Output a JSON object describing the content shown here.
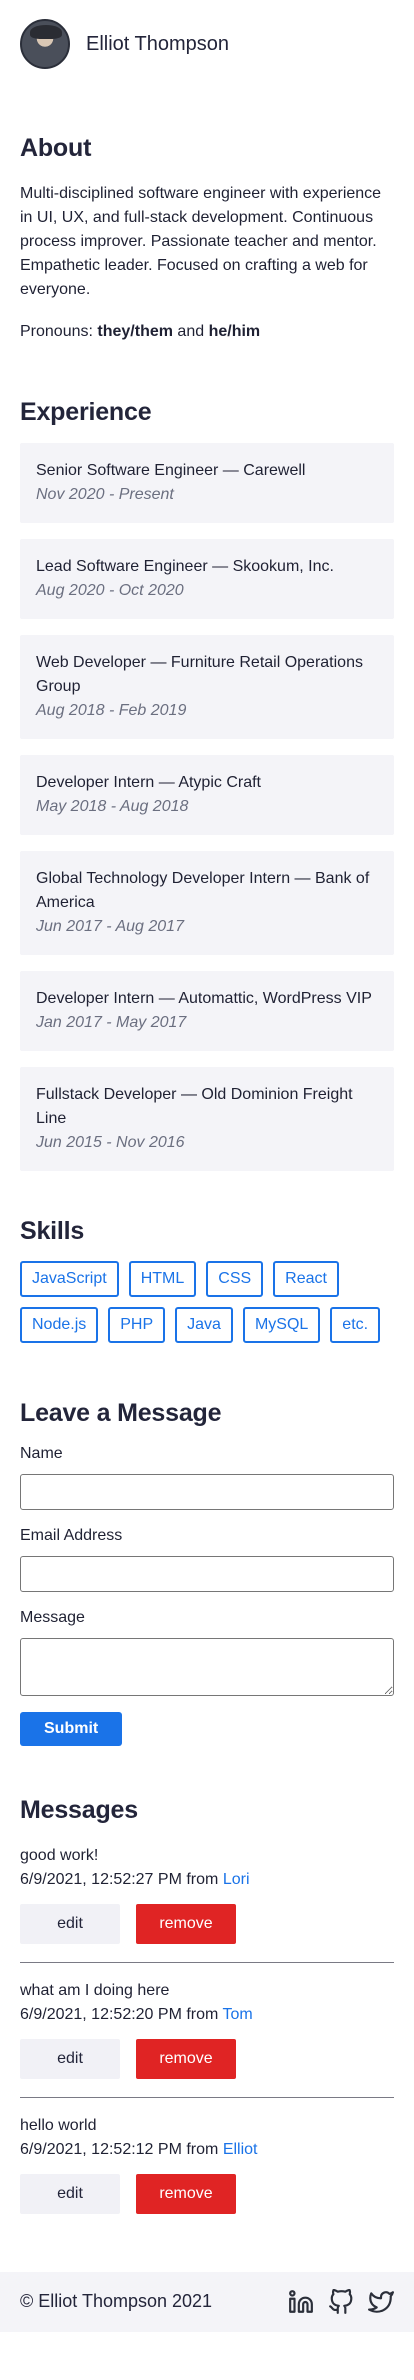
{
  "header": {
    "name": "Elliot Thompson"
  },
  "about": {
    "title": "About",
    "text": "Multi-disciplined software engineer with experience in UI, UX, and full-stack development. Continuous process improver. Passionate teacher and mentor. Empathetic leader. Focused on crafting a web for everyone.",
    "pronouns_label": "Pronouns:",
    "pronoun_1": "they/them",
    "pronoun_join": "and",
    "pronoun_2": "he/him"
  },
  "experience": {
    "title": "Experience",
    "items": [
      {
        "role": "Senior Software Engineer",
        "company": "Carewell",
        "dates": "Nov 2020 - Present"
      },
      {
        "role": "Lead Software Engineer",
        "company": "Skookum, Inc.",
        "dates": "Aug 2020 - Oct 2020"
      },
      {
        "role": "Web Developer",
        "company": "Furniture Retail Operations Group",
        "dates": "Aug 2018 - Feb 2019"
      },
      {
        "role": "Developer Intern",
        "company": "Atypic Craft",
        "dates": "May 2018 - Aug 2018"
      },
      {
        "role": "Global Technology Developer Intern",
        "company": "Bank of America",
        "dates": "Jun 2017 - Aug 2017"
      },
      {
        "role": "Developer Intern",
        "company": "Automattic, WordPress VIP",
        "dates": "Jan 2017 - May 2017"
      },
      {
        "role": "Fullstack Developer",
        "company": "Old Dominion Freight Line",
        "dates": "Jun 2015 - Nov 2016"
      }
    ],
    "separator": "—"
  },
  "skills": {
    "title": "Skills",
    "items": [
      "JavaScript",
      "HTML",
      "CSS",
      "React",
      "Node.js",
      "PHP",
      "Java",
      "MySQL",
      "etc."
    ]
  },
  "form": {
    "title": "Leave a Message",
    "name_label": "Name",
    "email_label": "Email Address",
    "message_label": "Message",
    "submit_label": "Submit"
  },
  "messages": {
    "title": "Messages",
    "from_label": "from",
    "edit_label": "edit",
    "remove_label": "remove",
    "items": [
      {
        "text": "good work!",
        "timestamp": "6/9/2021, 12:52:27 PM",
        "author": "Lori"
      },
      {
        "text": "what am I doing here",
        "timestamp": "6/9/2021, 12:52:20 PM",
        "author": "Tom"
      },
      {
        "text": "hello world",
        "timestamp": "6/9/2021, 12:52:12 PM",
        "author": "Elliot"
      }
    ]
  },
  "footer": {
    "copyright": "© Elliot Thompson 2021",
    "icons": [
      "linkedin-icon",
      "github-icon",
      "twitter-icon"
    ]
  },
  "colors": {
    "accent": "#1a73e8",
    "danger": "#e02424",
    "card_bg": "#f4f4f8",
    "text": "#1f2133"
  }
}
